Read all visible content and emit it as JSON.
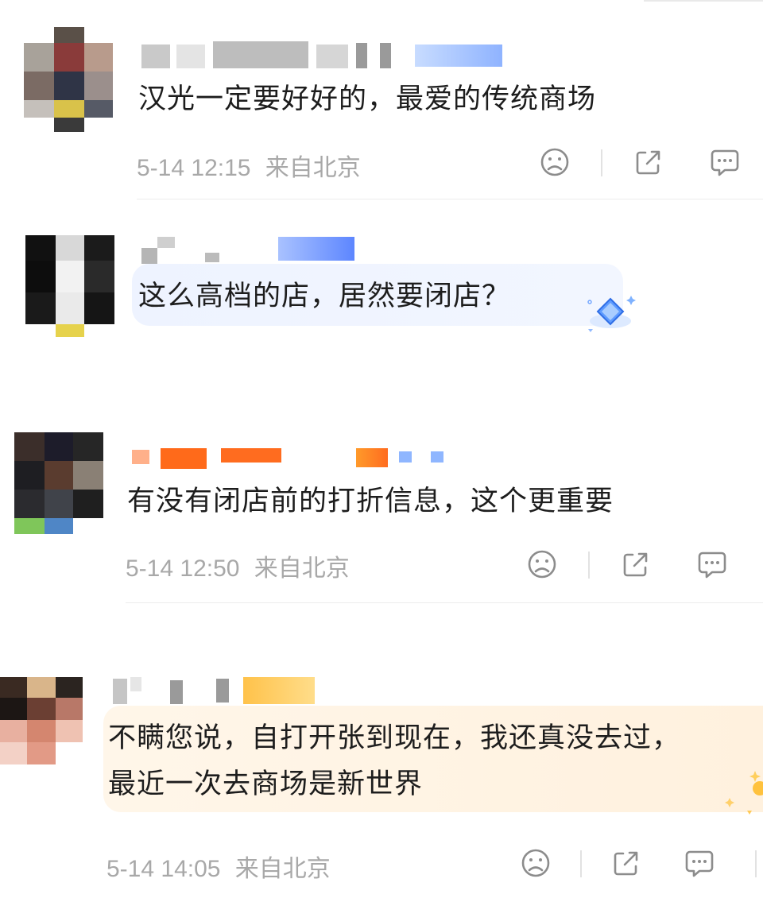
{
  "comments": [
    {
      "text": "汉光一定要好好的，最爱的传统商场",
      "time": "5-14 12:15",
      "location": "来自北京"
    },
    {
      "text": "这么高档的店，居然要闭店？"
    },
    {
      "text": "有没有闭店前的打折信息，这个更重要",
      "time": "5-14 12:50",
      "location": "来自北京"
    },
    {
      "text_lines": [
        "不瞒您说，自打开张到现在，我还真没去过，",
        "最近一次去商场是新世界"
      ],
      "time": "5-14 14:05",
      "location": "来自北京"
    }
  ],
  "icons": {
    "dislike": "sad-face-icon",
    "share": "share-icon",
    "reply": "comment-icon",
    "badge": "diamond-badge-icon"
  },
  "colors": {
    "text": "#1d1d1d",
    "meta": "#a8a8a8",
    "icon": "#8c8c8c",
    "bubble_blue": "#eef4ff",
    "bubble_gold": "#fff3e2"
  }
}
